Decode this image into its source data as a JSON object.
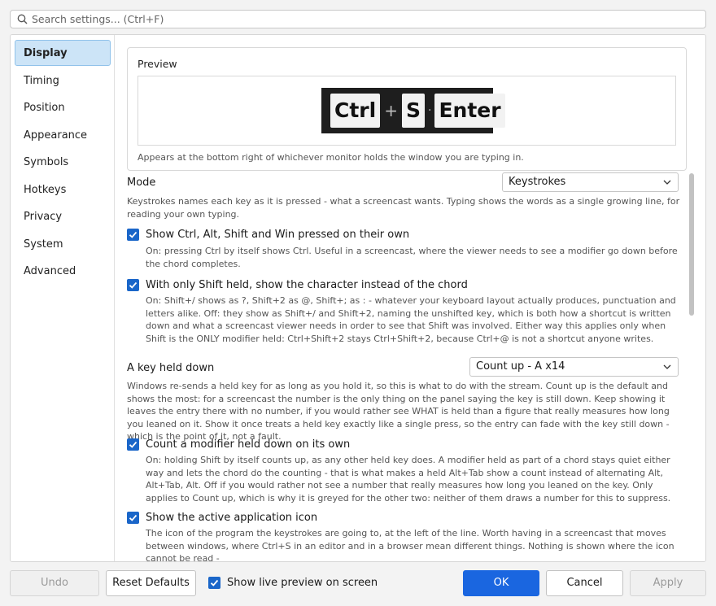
{
  "search": {
    "placeholder": "Search settings...  (Ctrl+F)"
  },
  "sidebar": {
    "items": [
      {
        "label": "Display"
      },
      {
        "label": "Timing"
      },
      {
        "label": "Position"
      },
      {
        "label": "Appearance"
      },
      {
        "label": "Symbols"
      },
      {
        "label": "Hotkeys"
      },
      {
        "label": "Privacy"
      },
      {
        "label": "System"
      },
      {
        "label": "Advanced"
      }
    ]
  },
  "preview": {
    "title": "Preview",
    "keys": [
      "Ctrl",
      "S",
      "Enter"
    ],
    "separators": [
      "+",
      "·"
    ],
    "caption": "Appears at the bottom right of whichever monitor holds the window you are typing in."
  },
  "mode": {
    "label": "Mode",
    "value": "Keystrokes",
    "desc": "Keystrokes names each key as it is pressed - what a screencast wants. Typing shows the words as a single growing line, for reading your own typing."
  },
  "mod_alone": {
    "label": "Show Ctrl, Alt, Shift and Win pressed on their own",
    "desc": "On: pressing Ctrl by itself shows Ctrl. Useful in a screencast, where the viewer needs to see a modifier go down before the chord completes."
  },
  "shift_char": {
    "label": "With only Shift held, show the character instead of the chord",
    "desc": "On: Shift+/ shows as ?, Shift+2 as @, Shift+; as : - whatever your keyboard layout actually produces, punctuation and letters alike. Off: they show as Shift+/ and Shift+2, naming the unshifted key, which is both how a shortcut is written down and what a screencast viewer needs in order to see that Shift was involved. Either way this applies only when Shift is the ONLY modifier held: Ctrl+Shift+2 stays Ctrl+Shift+2, because Ctrl+@ is not a shortcut anyone writes."
  },
  "held": {
    "label": "A key held down",
    "value": "Count up - A x14",
    "desc": "Windows re-sends a held key for as long as you hold it, so this is what to do with the stream. Count up is the default and shows the most: for a screencast the number is the only thing on the panel saying the key is still down. Keep showing it leaves the entry there with no number, if you would rather see WHAT is held than a figure that really measures how long you leaned on it. Show it once treats a held key exactly like a single press, so the entry can fade with the key still down - which is the point of it, not a fault."
  },
  "count_mod": {
    "label": "Count a modifier held down on its own",
    "desc": "On: holding Shift by itself counts up, as any other held key does. A modifier held as part of a chord stays quiet either way and lets the chord do the counting - that is what makes a held Alt+Tab show a count instead of alternating Alt, Alt+Tab, Alt. Off if you would rather not see a number that really measures how long you leaned on the key. Only applies to Count up, which is why it is greyed for the other two: neither of them draws a number for this to suppress."
  },
  "app_icon": {
    "label": "Show the active application icon",
    "desc": "The icon of the program the keystrokes are going to, at the left of the line. Worth having in a screencast that moves between windows, where Ctrl+S in an editor and in a browser mean different things. Nothing is shown where the icon cannot be read -"
  },
  "footer": {
    "undo": "Undo",
    "reset": "Reset Defaults",
    "live_preview": "Show live preview on screen",
    "ok": "OK",
    "cancel": "Cancel",
    "apply": "Apply"
  },
  "colors": {
    "accent": "#1a66e0",
    "nav_active_bg": "#cce4f7",
    "preview_bg": "#1e1e1e"
  }
}
